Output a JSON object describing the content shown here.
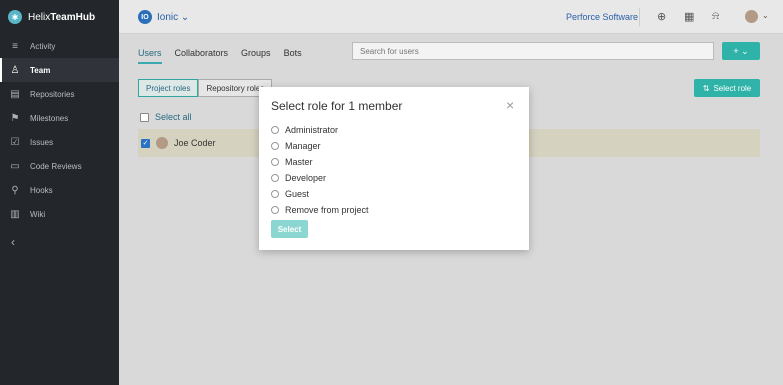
{
  "brand": {
    "name_light": "Helix",
    "name_bold": "TeamHub",
    "logo_icon": "hub-logo-icon"
  },
  "sidebar": {
    "items": [
      {
        "label": "Activity",
        "icon": "≡"
      },
      {
        "label": "Team",
        "icon": "♙",
        "active": true
      },
      {
        "label": "Repositories",
        "icon": "▤"
      },
      {
        "label": "Milestones",
        "icon": "⚑"
      },
      {
        "label": "Issues",
        "icon": "☑"
      },
      {
        "label": "Code Reviews",
        "icon": "▭"
      },
      {
        "label": "Hooks",
        "icon": "⚲"
      },
      {
        "label": "Wiki",
        "icon": "▥"
      }
    ],
    "collapse_icon": "‹"
  },
  "topbar": {
    "project_initials": "IO",
    "project_name": "Ionic ⌄",
    "org_link": "Perforce Software",
    "icons": {
      "add": "⊕",
      "grid": "▦",
      "bell": "⍾"
    },
    "user_caret": "⌄"
  },
  "team": {
    "tabs": [
      "Users",
      "Collaborators",
      "Groups",
      "Bots"
    ],
    "search_placeholder": "Search for users",
    "add_button": "+ ⌄",
    "segments": [
      "Project roles",
      "Repository roles"
    ],
    "select_role_button": "Select role",
    "select_role_icon": "⇅",
    "select_all_label": "Select all",
    "members": [
      {
        "name": "Joe Coder",
        "checked": true
      }
    ]
  },
  "modal": {
    "title": "Select role for 1 member",
    "close": "×",
    "options": [
      "Administrator",
      "Manager",
      "Master",
      "Developer",
      "Guest",
      "Remove from project"
    ],
    "select_button": "Select"
  },
  "colors": {
    "accent": "#2fb3a8",
    "link": "#2a5fa8",
    "sidebar_bg": "#23262b"
  }
}
